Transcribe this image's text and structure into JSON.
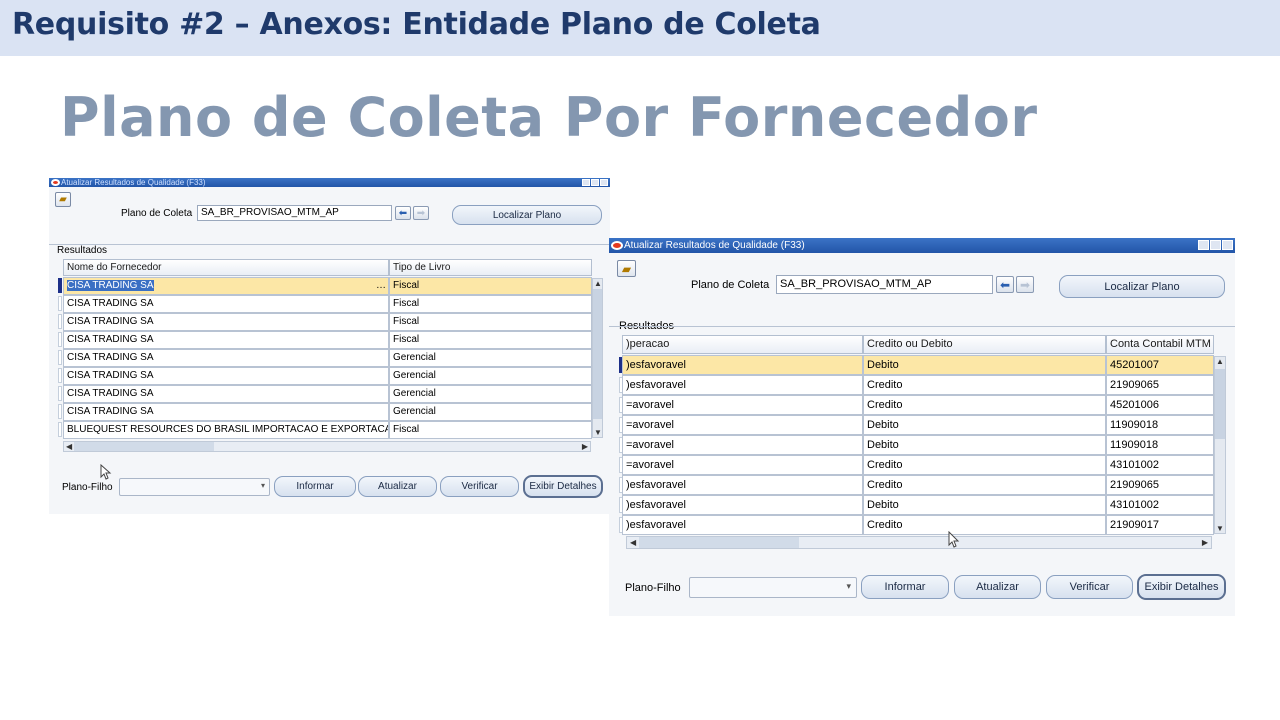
{
  "slide": {
    "header": "Requisito #2 – Anexos: Entidade Plano de Coleta",
    "title": "Plano de Coleta Por Fornecedor"
  },
  "colors": {
    "header_bg": "#dae3f3",
    "header_text": "#1f3a6b",
    "title_text": "#8497b0",
    "titlebar": "#2a5fb0",
    "selected_row": "#fce7a6"
  },
  "window1": {
    "title": "Atualizar Resultados de Qualidade (F33)",
    "plano_label": "Plano de Coleta",
    "plano_value": "SA_BR_PROVISAO_MTM_AP",
    "localizar": "Localizar Plano",
    "resultados": "Resultados",
    "columns": [
      "Nome do Fornecedor",
      "Tipo de Livro"
    ],
    "rows": [
      [
        "CISA TRADING SA",
        "Fiscal"
      ],
      [
        "CISA TRADING SA",
        "Fiscal"
      ],
      [
        "CISA TRADING SA",
        "Fiscal"
      ],
      [
        "CISA TRADING SA",
        "Fiscal"
      ],
      [
        "CISA TRADING SA",
        "Gerencial"
      ],
      [
        "CISA TRADING SA",
        "Gerencial"
      ],
      [
        "CISA TRADING SA",
        "Gerencial"
      ],
      [
        "CISA TRADING SA",
        "Gerencial"
      ],
      [
        "BLUEQUEST RESOURCES DO BRASIL IMPORTACAO E EXPORTACAO",
        "Fiscal"
      ]
    ],
    "plano_filho": "Plano-Filho",
    "buttons": [
      "Informar",
      "Atualizar",
      "Verificar",
      "Exibir Detalhes"
    ]
  },
  "window2": {
    "title": "Atualizar Resultados de Qualidade (F33)",
    "plano_label": "Plano de Coleta",
    "plano_value": "SA_BR_PROVISAO_MTM_AP",
    "localizar": "Localizar Plano",
    "resultados": "Resultados",
    "columns": [
      ")peracao",
      "Credito ou Debito",
      "Conta Contabil MTM"
    ],
    "rows": [
      [
        ")esfavoravel",
        "Debito",
        "45201007"
      ],
      [
        ")esfavoravel",
        "Credito",
        "21909065"
      ],
      [
        "=avoravel",
        "Credito",
        "45201006"
      ],
      [
        "=avoravel",
        "Debito",
        "11909018"
      ],
      [
        "=avoravel",
        "Debito",
        "11909018"
      ],
      [
        "=avoravel",
        "Credito",
        "43101002"
      ],
      [
        ")esfavoravel",
        "Credito",
        "21909065"
      ],
      [
        ")esfavoravel",
        "Debito",
        "43101002"
      ],
      [
        ")esfavoravel",
        "Credito",
        "21909017"
      ]
    ],
    "plano_filho": "Plano-Filho",
    "buttons": [
      "Informar",
      "Atualizar",
      "Verificar",
      "Exibir Detalhes"
    ]
  }
}
